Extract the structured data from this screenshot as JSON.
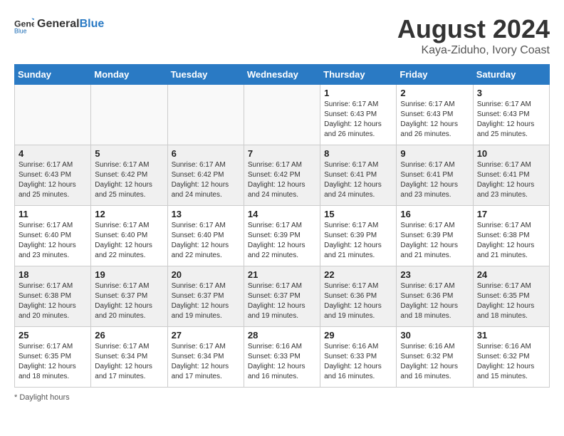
{
  "header": {
    "logo_line1": "General",
    "logo_line2": "Blue",
    "main_title": "August 2024",
    "sub_title": "Kaya-Ziduho, Ivory Coast"
  },
  "days_of_week": [
    "Sunday",
    "Monday",
    "Tuesday",
    "Wednesday",
    "Thursday",
    "Friday",
    "Saturday"
  ],
  "weeks": [
    [
      {
        "day": "",
        "info": ""
      },
      {
        "day": "",
        "info": ""
      },
      {
        "day": "",
        "info": ""
      },
      {
        "day": "",
        "info": ""
      },
      {
        "day": "1",
        "info": "Sunrise: 6:17 AM\nSunset: 6:43 PM\nDaylight: 12 hours and 26 minutes."
      },
      {
        "day": "2",
        "info": "Sunrise: 6:17 AM\nSunset: 6:43 PM\nDaylight: 12 hours and 26 minutes."
      },
      {
        "day": "3",
        "info": "Sunrise: 6:17 AM\nSunset: 6:43 PM\nDaylight: 12 hours and 25 minutes."
      }
    ],
    [
      {
        "day": "4",
        "info": "Sunrise: 6:17 AM\nSunset: 6:43 PM\nDaylight: 12 hours and 25 minutes."
      },
      {
        "day": "5",
        "info": "Sunrise: 6:17 AM\nSunset: 6:42 PM\nDaylight: 12 hours and 25 minutes."
      },
      {
        "day": "6",
        "info": "Sunrise: 6:17 AM\nSunset: 6:42 PM\nDaylight: 12 hours and 24 minutes."
      },
      {
        "day": "7",
        "info": "Sunrise: 6:17 AM\nSunset: 6:42 PM\nDaylight: 12 hours and 24 minutes."
      },
      {
        "day": "8",
        "info": "Sunrise: 6:17 AM\nSunset: 6:41 PM\nDaylight: 12 hours and 24 minutes."
      },
      {
        "day": "9",
        "info": "Sunrise: 6:17 AM\nSunset: 6:41 PM\nDaylight: 12 hours and 23 minutes."
      },
      {
        "day": "10",
        "info": "Sunrise: 6:17 AM\nSunset: 6:41 PM\nDaylight: 12 hours and 23 minutes."
      }
    ],
    [
      {
        "day": "11",
        "info": "Sunrise: 6:17 AM\nSunset: 6:40 PM\nDaylight: 12 hours and 23 minutes."
      },
      {
        "day": "12",
        "info": "Sunrise: 6:17 AM\nSunset: 6:40 PM\nDaylight: 12 hours and 22 minutes."
      },
      {
        "day": "13",
        "info": "Sunrise: 6:17 AM\nSunset: 6:40 PM\nDaylight: 12 hours and 22 minutes."
      },
      {
        "day": "14",
        "info": "Sunrise: 6:17 AM\nSunset: 6:39 PM\nDaylight: 12 hours and 22 minutes."
      },
      {
        "day": "15",
        "info": "Sunrise: 6:17 AM\nSunset: 6:39 PM\nDaylight: 12 hours and 21 minutes."
      },
      {
        "day": "16",
        "info": "Sunrise: 6:17 AM\nSunset: 6:39 PM\nDaylight: 12 hours and 21 minutes."
      },
      {
        "day": "17",
        "info": "Sunrise: 6:17 AM\nSunset: 6:38 PM\nDaylight: 12 hours and 21 minutes."
      }
    ],
    [
      {
        "day": "18",
        "info": "Sunrise: 6:17 AM\nSunset: 6:38 PM\nDaylight: 12 hours and 20 minutes."
      },
      {
        "day": "19",
        "info": "Sunrise: 6:17 AM\nSunset: 6:37 PM\nDaylight: 12 hours and 20 minutes."
      },
      {
        "day": "20",
        "info": "Sunrise: 6:17 AM\nSunset: 6:37 PM\nDaylight: 12 hours and 19 minutes."
      },
      {
        "day": "21",
        "info": "Sunrise: 6:17 AM\nSunset: 6:37 PM\nDaylight: 12 hours and 19 minutes."
      },
      {
        "day": "22",
        "info": "Sunrise: 6:17 AM\nSunset: 6:36 PM\nDaylight: 12 hours and 19 minutes."
      },
      {
        "day": "23",
        "info": "Sunrise: 6:17 AM\nSunset: 6:36 PM\nDaylight: 12 hours and 18 minutes."
      },
      {
        "day": "24",
        "info": "Sunrise: 6:17 AM\nSunset: 6:35 PM\nDaylight: 12 hours and 18 minutes."
      }
    ],
    [
      {
        "day": "25",
        "info": "Sunrise: 6:17 AM\nSunset: 6:35 PM\nDaylight: 12 hours and 18 minutes."
      },
      {
        "day": "26",
        "info": "Sunrise: 6:17 AM\nSunset: 6:34 PM\nDaylight: 12 hours and 17 minutes."
      },
      {
        "day": "27",
        "info": "Sunrise: 6:17 AM\nSunset: 6:34 PM\nDaylight: 12 hours and 17 minutes."
      },
      {
        "day": "28",
        "info": "Sunrise: 6:16 AM\nSunset: 6:33 PM\nDaylight: 12 hours and 16 minutes."
      },
      {
        "day": "29",
        "info": "Sunrise: 6:16 AM\nSunset: 6:33 PM\nDaylight: 12 hours and 16 minutes."
      },
      {
        "day": "30",
        "info": "Sunrise: 6:16 AM\nSunset: 6:32 PM\nDaylight: 12 hours and 16 minutes."
      },
      {
        "day": "31",
        "info": "Sunrise: 6:16 AM\nSunset: 6:32 PM\nDaylight: 12 hours and 15 minutes."
      }
    ]
  ],
  "footer": "Daylight hours"
}
